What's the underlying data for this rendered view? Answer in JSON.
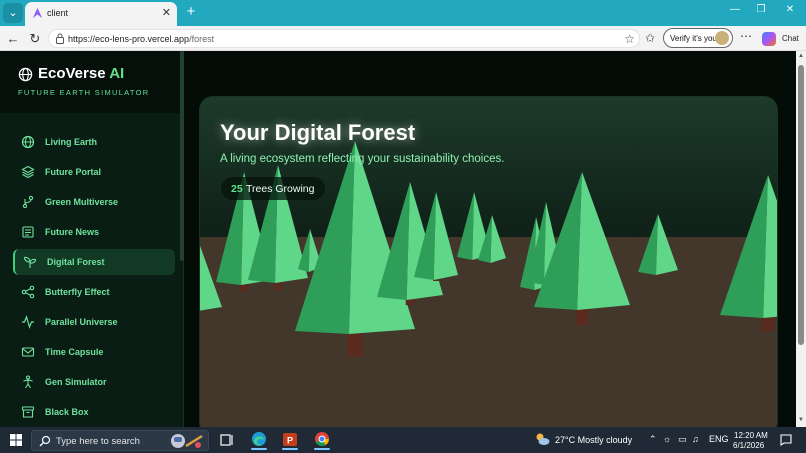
{
  "browser": {
    "tab_title": "client",
    "url_host": "https://eco-lens-pro.vercel.app",
    "url_path": "/forest",
    "verify_label": "Verify it's you",
    "chat_label": "Chat",
    "more_label": "⋯",
    "new_tab": "+",
    "tab_close": "✕"
  },
  "brand": {
    "name": "EcoVerse",
    "ai": "AI",
    "subtitle": "FUTURE EARTH SIMULATOR"
  },
  "sidebar": {
    "items": [
      {
        "label": "Living Earth",
        "icon": "globe-icon",
        "active": false
      },
      {
        "label": "Future Portal",
        "icon": "layers-icon",
        "active": false
      },
      {
        "label": "Green Multiverse",
        "icon": "branch-icon",
        "active": false
      },
      {
        "label": "Future News",
        "icon": "newspaper-icon",
        "active": false
      },
      {
        "label": "Digital Forest",
        "icon": "sprout-icon",
        "active": true
      },
      {
        "label": "Butterfly Effect",
        "icon": "share-icon",
        "active": false
      },
      {
        "label": "Parallel Universe",
        "icon": "activity-icon",
        "active": false
      },
      {
        "label": "Time Capsule",
        "icon": "mail-icon",
        "active": false
      },
      {
        "label": "Gen Simulator",
        "icon": "person-icon",
        "active": false
      },
      {
        "label": "Black Box",
        "icon": "archive-icon",
        "active": false
      }
    ]
  },
  "hero": {
    "title": "Your Digital Forest",
    "subtitle": "A living ecosystem reflecting your sustainability choices.",
    "tree_count": "25",
    "tree_label": "Trees Growing"
  },
  "taskbar": {
    "search_placeholder": "Type here to search",
    "weather": "27°C  Mostly cloudy",
    "lang": "ENG",
    "time": "12:20 AM",
    "date": "6/1/2026"
  },
  "colors": {
    "accent": "#5ee08c",
    "sidebar_bg": "#0a1d14",
    "ground": "#43362b",
    "tree_light": "#5fd688",
    "tree_dark": "#2f9e58",
    "trunk": "#5a2a1e"
  }
}
